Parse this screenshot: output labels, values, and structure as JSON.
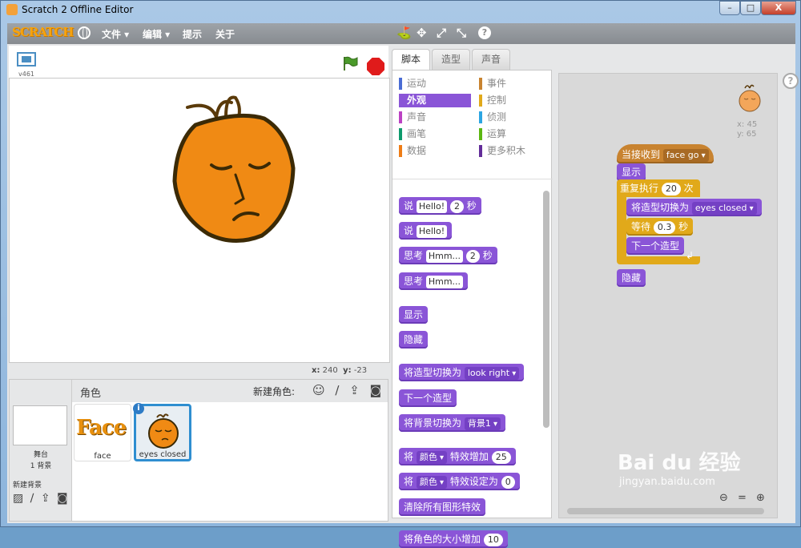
{
  "window": {
    "title": "Scratch 2 Offline Editor",
    "minimize": "–",
    "maximize": "□",
    "close": "X"
  },
  "menubar": {
    "logo": "SCRATCH",
    "items": [
      "文件 ▾",
      "编辑 ▾",
      "提示",
      "关于"
    ],
    "tools": [
      "⛳",
      "✥",
      "⤢",
      "⤡",
      "?"
    ]
  },
  "stage_header": {
    "version": "v461"
  },
  "coords": {
    "x_label": "x:",
    "x": "240",
    "y_label": "y:",
    "y": "-23"
  },
  "sprites": {
    "title": "角色",
    "new_sprite_label": "新建角色:",
    "tools": "☺ ∕ ⇪ ◙",
    "stage_label": "舞台",
    "stage_bg_count": "1 背景",
    "new_backdrop_label": "新建背景",
    "backdrop_tools": "▨ ∕ ⇪ ◙",
    "list": [
      {
        "name": "face",
        "thumb_text": "Face"
      },
      {
        "name": "eyes closed",
        "info": "i"
      }
    ]
  },
  "tabs": [
    "脚本",
    "造型",
    "声音"
  ],
  "categories": [
    {
      "label": "运动",
      "color": "#4a6cd4"
    },
    {
      "label": "事件",
      "color": "#c88330"
    },
    {
      "label": "外观",
      "color": "#8a55d7",
      "active": true
    },
    {
      "label": "控制",
      "color": "#e1a91a"
    },
    {
      "label": "声音",
      "color": "#bb42c3"
    },
    {
      "label": "侦测",
      "color": "#2ca5e2"
    },
    {
      "label": "画笔",
      "color": "#0e9a6c"
    },
    {
      "label": "运算",
      "color": "#5cb712"
    },
    {
      "label": "数据",
      "color": "#ee7d16"
    },
    {
      "label": "更多积木",
      "color": "#632d99"
    }
  ],
  "palette_blocks": {
    "say_secs": {
      "a": "说",
      "text": "Hello!",
      "num": "2",
      "b": "秒"
    },
    "say": {
      "a": "说",
      "text": "Hello!"
    },
    "think_secs": {
      "a": "思考",
      "text": "Hmm...",
      "num": "2",
      "b": "秒"
    },
    "think": {
      "a": "思考",
      "text": "Hmm..."
    },
    "show": "显示",
    "hide": "隐藏",
    "switch_costume": {
      "a": "将造型切换为",
      "dd": "look right"
    },
    "next_costume": "下一个造型",
    "switch_backdrop": {
      "a": "将背景切换为",
      "dd": "背景1"
    },
    "change_effect": {
      "a": "将",
      "dd": "颜色",
      "b": "特效增加",
      "num": "25"
    },
    "set_effect": {
      "a": "将",
      "dd": "颜色",
      "b": "特效设定为",
      "num": "0"
    },
    "clear_effects": "清除所有图形特效",
    "change_size": {
      "a": "将角色的大小增加",
      "num": "10"
    }
  },
  "script_area": {
    "help": "?",
    "sprite_x": "x: 45",
    "sprite_y": "y: 65",
    "zoom_tools": "⊖ = ⊕",
    "script": {
      "hat": {
        "a": "当接收到",
        "dd": "face go"
      },
      "show": "显示",
      "repeat": {
        "a": "重复执行",
        "num": "20",
        "b": "次"
      },
      "switch": {
        "a": "将造型切换为",
        "dd": "eyes closed"
      },
      "wait": {
        "a": "等待",
        "num": "0.3",
        "b": "秒"
      },
      "next": "下一个造型",
      "loop_arrow": "↲",
      "hide": "隐藏"
    }
  },
  "watermark": {
    "brand": "Bai du 经验",
    "url": "jingyan.baidu.com"
  }
}
